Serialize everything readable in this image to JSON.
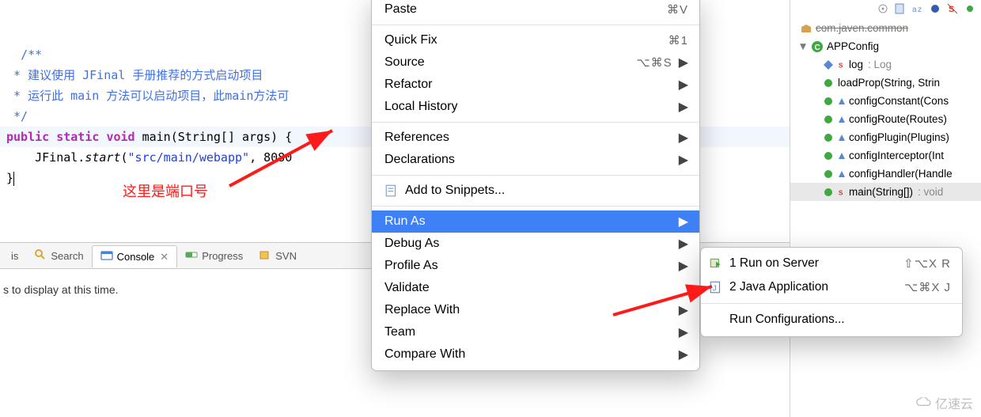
{
  "code": {
    "line1": "/**",
    "line2_pre": " * 建议使用 ",
    "line2_jf": "JFinal",
    "line2_post": " 手册推荐的方式启动项目",
    "line3": " * 运行此 main 方法可以启动项目，此main方法可",
    "line4": " */",
    "line5_kw1": "public",
    "line5_kw2": "static",
    "line5_kw3": "void",
    "line5_rest": " main(String[] args) {",
    "line6_pre": "    JFinal.",
    "line6_meth": "start",
    "line6_paren": "(",
    "line6_str": "\"src/main/webapp\"",
    "line6_post": ", 8080",
    "line7": "}"
  },
  "annotation": "这里是端口号",
  "tabs": {
    "partial": "is",
    "search": "Search",
    "console": "Console",
    "progress": "Progress",
    "svn": "SVN"
  },
  "console_text": "s to display at this time.",
  "menu": {
    "paste": "Paste",
    "paste_sc": "⌘V",
    "quickfix": "Quick Fix",
    "quickfix_sc": "⌘1",
    "source": "Source",
    "source_sc": "⌥⌘S",
    "refactor": "Refactor",
    "localhist": "Local History",
    "refs": "References",
    "decl": "Declarations",
    "snippets": "Add to Snippets...",
    "runas": "Run As",
    "debugas": "Debug As",
    "profileas": "Profile As",
    "validate": "Validate",
    "replace": "Replace With",
    "team": "Team",
    "compare": "Compare With"
  },
  "submenu": {
    "i1": "1 Run on Server",
    "i1_sc": "⇧⌥X R",
    "i2": "2 Java Application",
    "i2_sc": "⌥⌘X J",
    "config": "Run Configurations..."
  },
  "outline": {
    "pkg": "com.javen.common",
    "cls": "APPConfig",
    "field": "log",
    "field_type": " : Log",
    "m1": "loadProp(String, Strin",
    "m2": "configConstant(Cons",
    "m3": "configRoute(Routes)",
    "m4": "configPlugin(Plugins)",
    "m5": "configInterceptor(Int",
    "m6": "configHandler(Handle",
    "m7": "main(String[])",
    "m7_type": " : void"
  },
  "watermark": "亿速云"
}
